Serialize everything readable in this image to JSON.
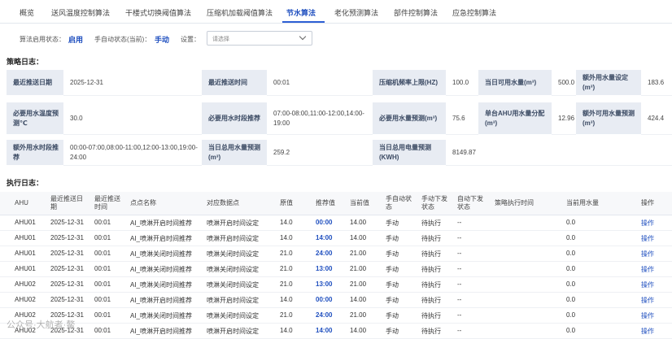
{
  "tabs": [
    {
      "label": "概览"
    },
    {
      "label": "送风温度控制算法"
    },
    {
      "label": "干楼式切换阈值算法"
    },
    {
      "label": "压缩机加载阈值算法"
    },
    {
      "label": "节水算法"
    },
    {
      "label": "老化预测算法"
    },
    {
      "label": "部件控制算法"
    },
    {
      "label": "应急控制算法"
    }
  ],
  "active_tab": "节水算法",
  "controls": {
    "enable_label": "算法启用状态：",
    "enable_value": "启用",
    "manual_label": "手自动状态(当前)：",
    "manual_value": "手动",
    "setting_label": "设置：",
    "setting_placeholder": "请选择"
  },
  "strategy_title": "策略日志：",
  "strategy_rows": [
    [
      {
        "label": "最近推送日期",
        "value": "2025-12-31"
      },
      {
        "label": "最近推送时间",
        "value": "00:01"
      },
      {
        "label": "压缩机频率上限(HZ)",
        "value": "100.0"
      },
      {
        "label": "当日可用水量(m³)",
        "value": "500.0"
      },
      {
        "label": "额外用水量设定(m³)",
        "value": "183.6"
      }
    ],
    [
      {
        "label": "必要用水温度预测℃",
        "value": "30.0"
      },
      {
        "label": "必要用水时段推荐",
        "value": "07:00-08:00,11:00-12:00,14:00-19:00"
      },
      {
        "label": "必要用水量预测(m³)",
        "value": "75.6"
      },
      {
        "label": "单台AHU用水量分配(m³)",
        "value": "12.96"
      },
      {
        "label": "额外可用水量预测(m³)",
        "value": "424.4"
      }
    ],
    [
      {
        "label": "额外用水时段推荐",
        "value": "00:00-07:00,08:00-11:00,12:00-13:00,19:00-24:00"
      },
      {
        "label": "当日总用水量预测(m³)",
        "value": "259.2"
      },
      {
        "label": "当日总用电量预测(KWH)",
        "value": "8149.87"
      }
    ]
  ],
  "exec_title": "执行日志：",
  "exec_headers": [
    "AHU",
    "最近推送日期",
    "最近推送时间",
    "点点名称",
    "对应数据点",
    "原值",
    "推荐值",
    "当前值",
    "手自动状态",
    "手动下发状态",
    "自动下发状态",
    "策略执行时间",
    "当前用水量",
    "操作"
  ],
  "exec_rows": [
    [
      "AHU01",
      "2025-12-31",
      "00:01",
      "AI_喷淋开启时间推荐",
      "喷淋开启时间设定",
      "14.0",
      "00:00",
      "14.00",
      "手动",
      "待执行",
      "--",
      "",
      "0.0",
      "操作"
    ],
    [
      "AHU01",
      "2025-12-31",
      "00:01",
      "AI_喷淋开启时间推荐",
      "喷淋开启时间设定",
      "14.0",
      "14:00",
      "14.00",
      "手动",
      "待执行",
      "--",
      "",
      "0.0",
      "操作"
    ],
    [
      "AHU01",
      "2025-12-31",
      "00:01",
      "AI_喷淋关闭时间推荐",
      "喷淋关闭时间设定",
      "21.0",
      "24:00",
      "21.00",
      "手动",
      "待执行",
      "--",
      "",
      "0.0",
      "操作"
    ],
    [
      "AHU01",
      "2025-12-31",
      "00:01",
      "AI_喷淋关闭时间推荐",
      "喷淋关闭时间设定",
      "21.0",
      "13:00",
      "21.00",
      "手动",
      "待执行",
      "--",
      "",
      "0.0",
      "操作"
    ],
    [
      "AHU02",
      "2025-12-31",
      "00:01",
      "AI_喷淋关闭时间推荐",
      "喷淋关闭时间设定",
      "21.0",
      "13:00",
      "21.00",
      "手动",
      "待执行",
      "--",
      "",
      "0.0",
      "操作"
    ],
    [
      "AHU02",
      "2025-12-31",
      "00:01",
      "AI_喷淋开启时间推荐",
      "喷淋开启时间设定",
      "14.0",
      "00:00",
      "14.00",
      "手动",
      "待执行",
      "--",
      "",
      "0.0",
      "操作"
    ],
    [
      "AHU02",
      "2025-12-31",
      "00:01",
      "AI_喷淋关闭时间推荐",
      "喷淋关闭时间设定",
      "21.0",
      "24:00",
      "21.00",
      "手动",
      "待执行",
      "--",
      "",
      "0.0",
      "操作"
    ],
    [
      "AHU02",
      "2025-12-31",
      "00:01",
      "AI_喷淋开启时间推荐",
      "喷淋开启时间设定",
      "14.0",
      "14:00",
      "14.00",
      "手动",
      "待执行",
      "--",
      "",
      "0.0",
      "操作"
    ]
  ],
  "watermark": "公众号·大航者·鳌"
}
